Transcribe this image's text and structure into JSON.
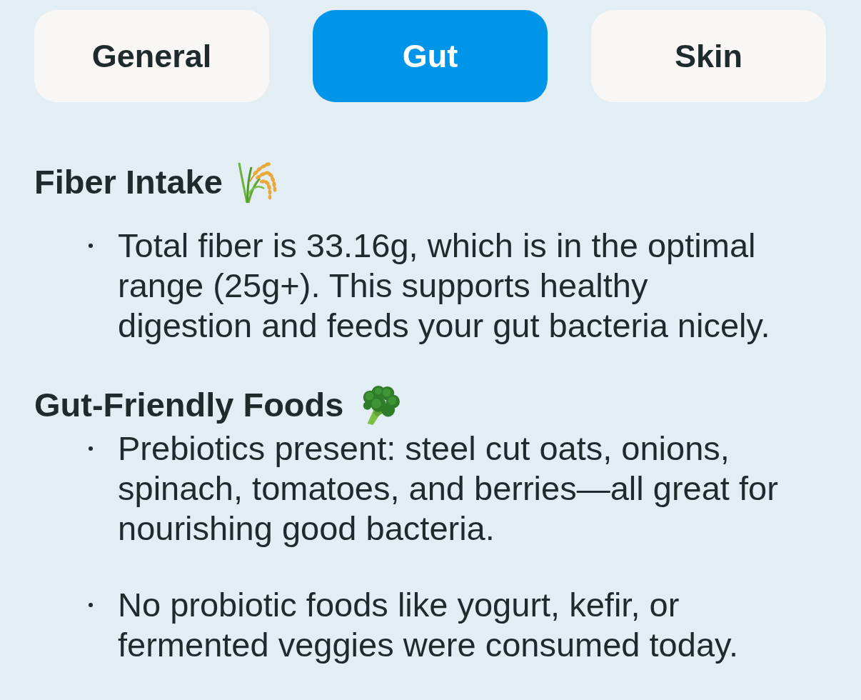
{
  "tabs": [
    {
      "label": "General",
      "selected": false
    },
    {
      "label": "Gut",
      "selected": true
    },
    {
      "label": "Skin",
      "selected": false
    }
  ],
  "sections": [
    {
      "heading": "Fiber Intake",
      "bullets": [
        "Total fiber is 33.16g, which is in the optimal range (25g+). This supports healthy digestion and feeds your gut bacteria nicely."
      ]
    },
    {
      "heading": "Gut-Friendly Foods",
      "bullets": [
        "Prebiotics present: steel cut oats, onions, spinach, tomatoes, and berries—all great for nourishing good bacteria.",
        "No probiotic foods like yogurt, kefir, or fermented veggies were consumed today."
      ]
    }
  ]
}
